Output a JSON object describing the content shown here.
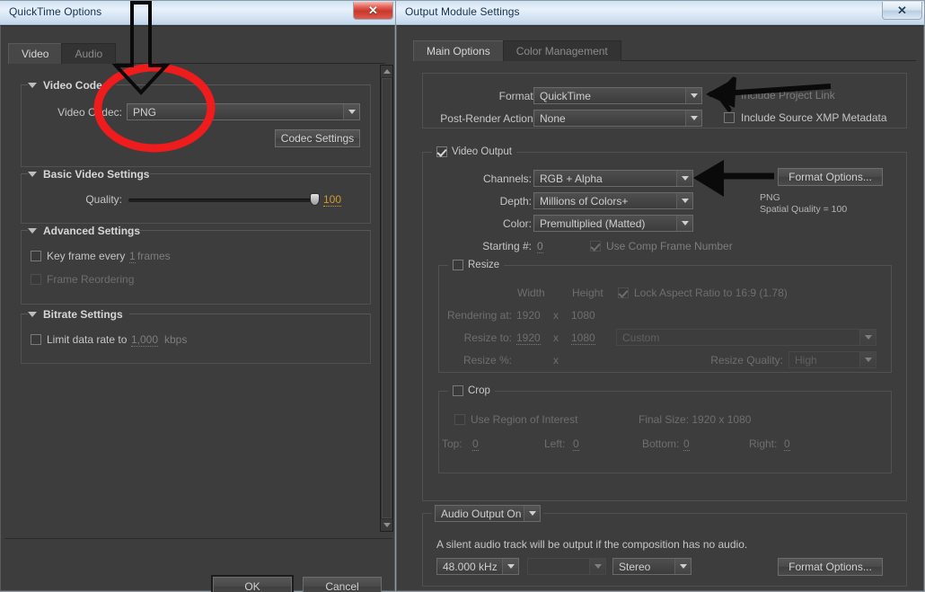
{
  "colors": {
    "accent_orange": "#d19a2e",
    "annotation_red": "#ee1c1c",
    "annotation_black": "#0a0a0a",
    "dialog_bg": "#3d3d3d",
    "close_red": "#c9372c"
  },
  "quicktime_dialog": {
    "title": "QuickTime Options",
    "close_label": "✕",
    "tabs": [
      {
        "label": "Video",
        "active": true
      },
      {
        "label": "Audio",
        "active": false
      }
    ],
    "video_codec_group": {
      "heading": "Video Codec",
      "codec_label": "Video Codec:",
      "codec_value": "PNG",
      "codec_settings_button": "Codec Settings"
    },
    "basic_video_group": {
      "heading": "Basic Video Settings",
      "quality_label": "Quality:",
      "quality_value": "100"
    },
    "advanced_group": {
      "heading": "Advanced Settings",
      "key_frame_label": "Key frame every",
      "key_frame_value": "1",
      "key_frame_units": "frames",
      "frame_reordering_label": "Frame Reordering"
    },
    "bitrate_group": {
      "heading": "Bitrate Settings",
      "limit_label": "Limit data rate to",
      "limit_value": "1,000",
      "limit_units": "kbps"
    },
    "ok_button": "OK",
    "cancel_button": "Cancel"
  },
  "output_module_dialog": {
    "title": "Output Module Settings",
    "close_label": "✕",
    "tabs": [
      {
        "label": "Main Options",
        "active": true
      },
      {
        "label": "Color Management",
        "active": false
      }
    ],
    "format_section": {
      "format_label": "Format:",
      "format_value": "QuickTime",
      "post_render_label": "Post-Render Action:",
      "post_render_value": "None",
      "include_project_link_label": "Include Project Link",
      "include_project_link_checked": true,
      "include_xmp_label": "Include Source XMP Metadata",
      "include_xmp_checked": false
    },
    "video_output": {
      "group_label": "Video Output",
      "group_checked": true,
      "channels_label": "Channels:",
      "channels_value": "RGB + Alpha",
      "depth_label": "Depth:",
      "depth_value": "Millions of Colors+",
      "color_label": "Color:",
      "color_value": "Premultiplied (Matted)",
      "starting_num_label": "Starting #:",
      "starting_num_value": "0",
      "use_comp_frame_label": "Use Comp Frame Number",
      "use_comp_frame_checked": true,
      "format_options_button": "Format Options...",
      "format_info_line1": "PNG",
      "format_info_line2": "Spatial Quality = 100"
    },
    "resize": {
      "group_label": "Resize",
      "group_checked": false,
      "width_header": "Width",
      "height_header": "Height",
      "lock_aspect_label": "Lock Aspect Ratio to 16:9 (1.78)",
      "lock_aspect_checked": true,
      "rendering_at_label": "Rendering at:",
      "rendering_width": "1920",
      "rendering_x": "x",
      "rendering_height": "1080",
      "resize_to_label": "Resize to:",
      "resize_width": "1920",
      "resize_x": "x",
      "resize_height": "1080",
      "preset_value": "Custom",
      "resize_pct_label": "Resize %:",
      "resize_pct_x": "x",
      "resize_quality_label": "Resize Quality:",
      "resize_quality_value": "High"
    },
    "crop": {
      "group_label": "Crop",
      "group_checked": false,
      "use_roi_label": "Use Region of Interest",
      "use_roi_checked": false,
      "final_size_label": "Final Size: 1920 x 1080",
      "top_label": "Top:",
      "top_value": "0",
      "left_label": "Left:",
      "left_value": "0",
      "bottom_label": "Bottom:",
      "bottom_value": "0",
      "right_label": "Right:",
      "right_value": "0"
    },
    "audio": {
      "output_toggle_value": "Audio Output On",
      "note": "A silent audio track will be output if the composition has no audio.",
      "sample_rate_value": "48.000 kHz",
      "bit_depth_value": "",
      "channels_value": "Stereo",
      "format_options_button": "Format Options..."
    }
  },
  "annotations": {
    "red_ellipse_target": "Video Codec: PNG dropdown",
    "arrow_1_target": "Video Codec dropdown",
    "arrow_2_target": "Format: QuickTime dropdown",
    "arrow_3_target": "Channels: RGB + Alpha dropdown"
  }
}
